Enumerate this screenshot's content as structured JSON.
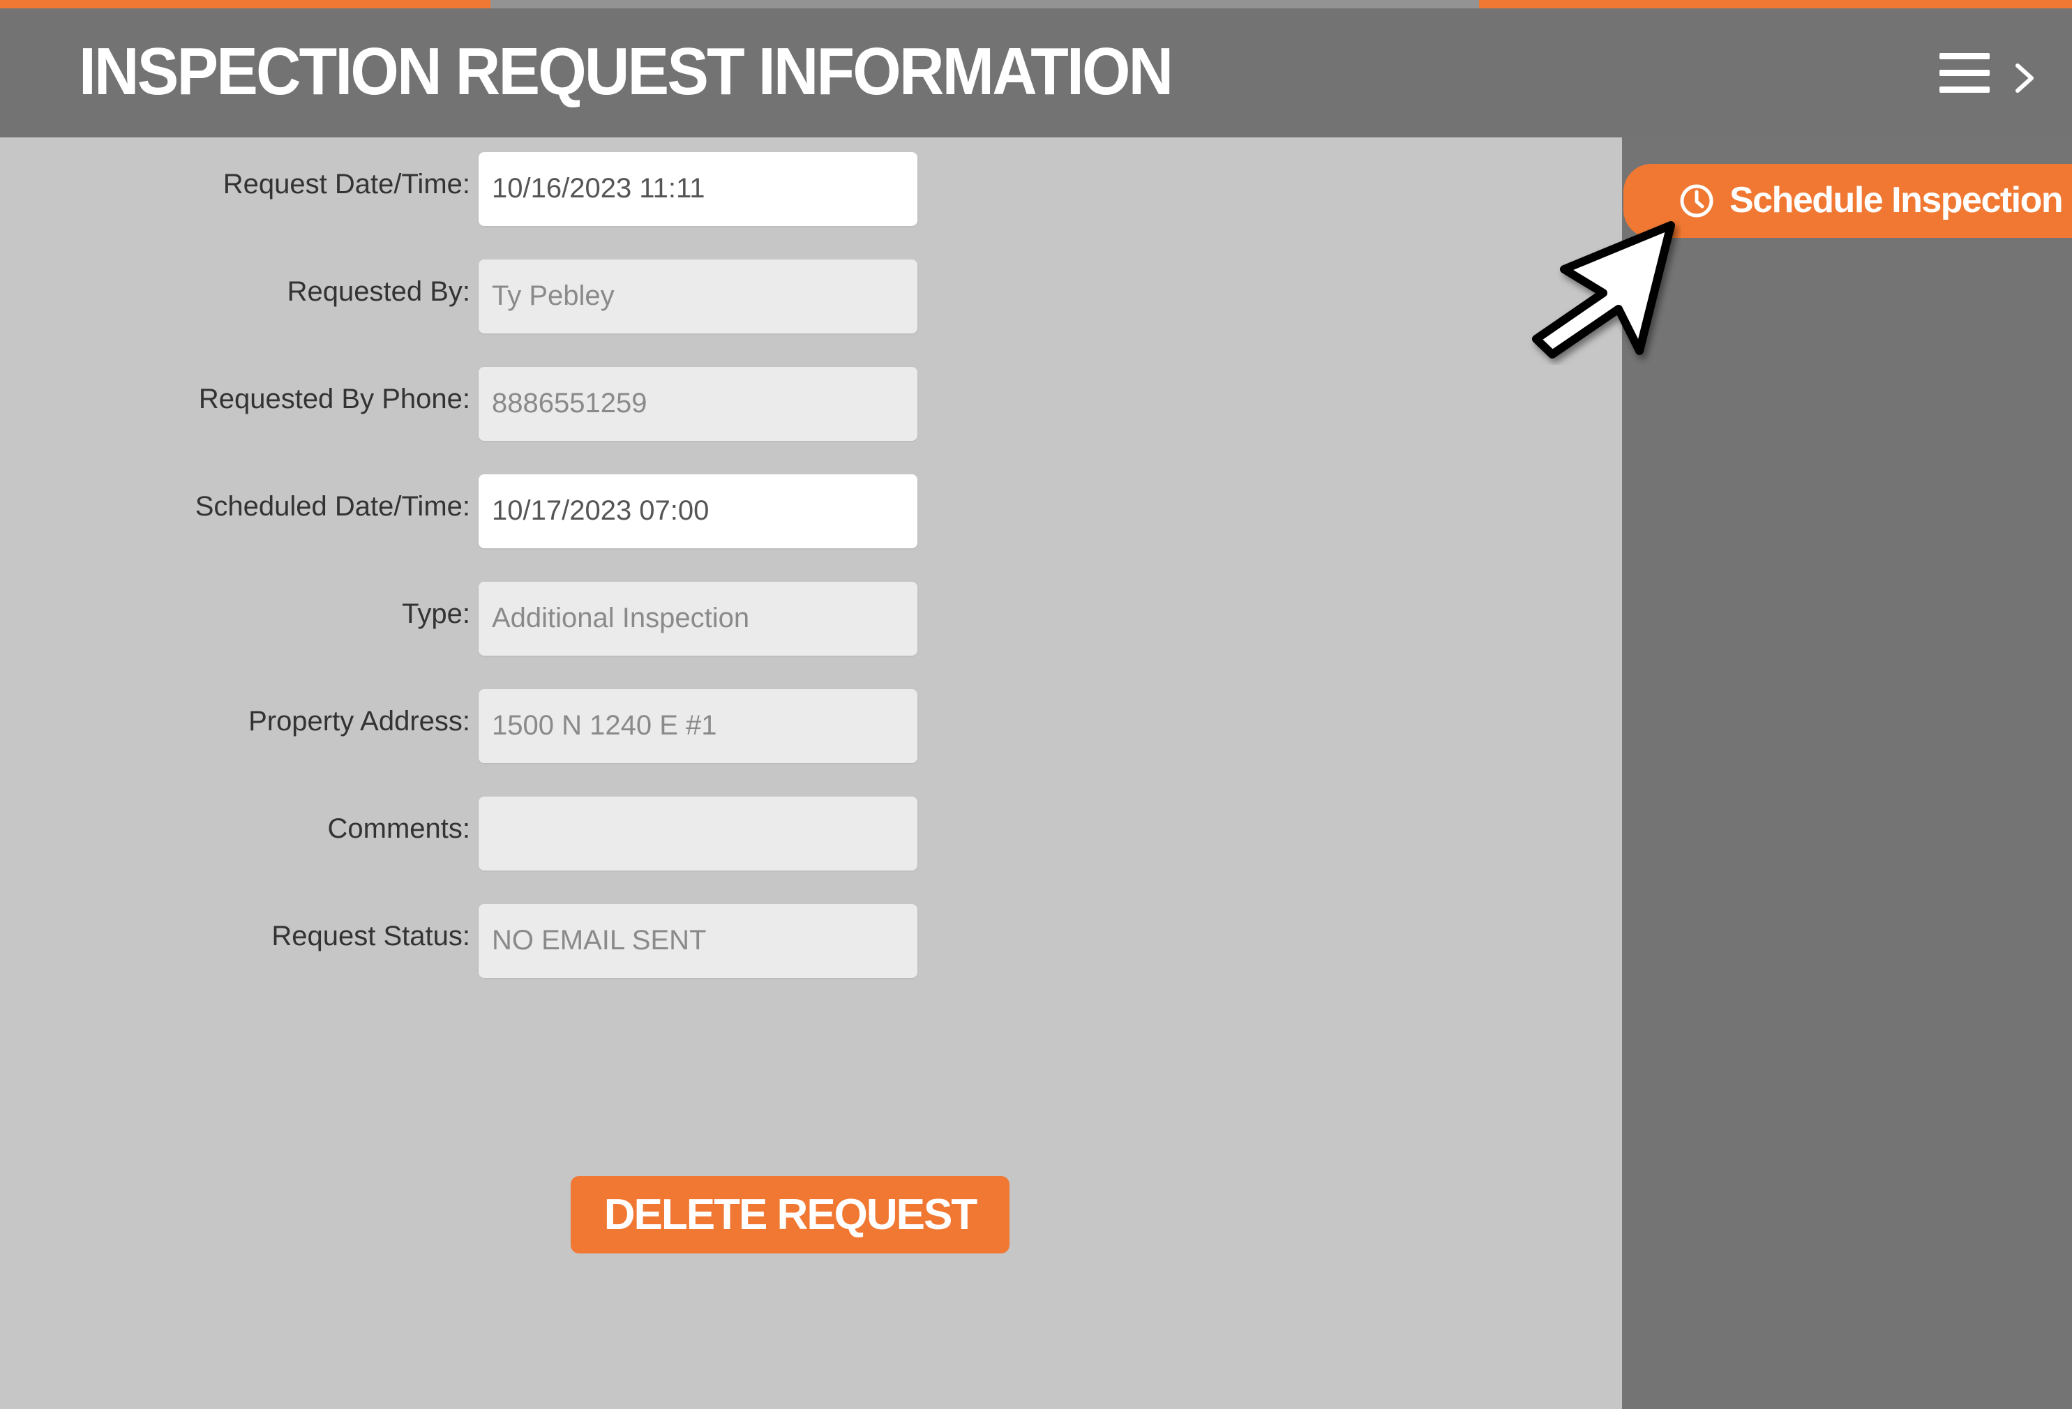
{
  "header": {
    "title": "INSPECTION REQUEST INFORMATION",
    "menu_icon": "hamburger-menu-icon",
    "expand_icon": "chevron-right-icon"
  },
  "form": {
    "fields": [
      {
        "label": "Request Date/Time:",
        "value": "10/16/2023 11:11",
        "editable": true
      },
      {
        "label": "Requested By:",
        "value": "Ty Pebley",
        "editable": false
      },
      {
        "label": "Requested By Phone:",
        "value": "8886551259",
        "editable": false
      },
      {
        "label": "Scheduled Date/Time:",
        "value": "10/17/2023 07:00",
        "editable": true
      },
      {
        "label": "Type:",
        "value": "Additional Inspection",
        "editable": false
      },
      {
        "label": "Property Address:",
        "value": "1500 N 1240 E #1",
        "editable": false
      },
      {
        "label": "Comments:",
        "value": "",
        "editable": false
      },
      {
        "label": "Request Status:",
        "value": "NO EMAIL SENT",
        "editable": false
      }
    ],
    "delete_label": "DELETE REQUEST"
  },
  "side_panel": {
    "schedule_label": "Schedule Inspection",
    "schedule_icon": "clock-icon"
  },
  "colors": {
    "accent": "#f07832",
    "header_bg": "#737373",
    "content_bg": "#c6c6c6"
  }
}
